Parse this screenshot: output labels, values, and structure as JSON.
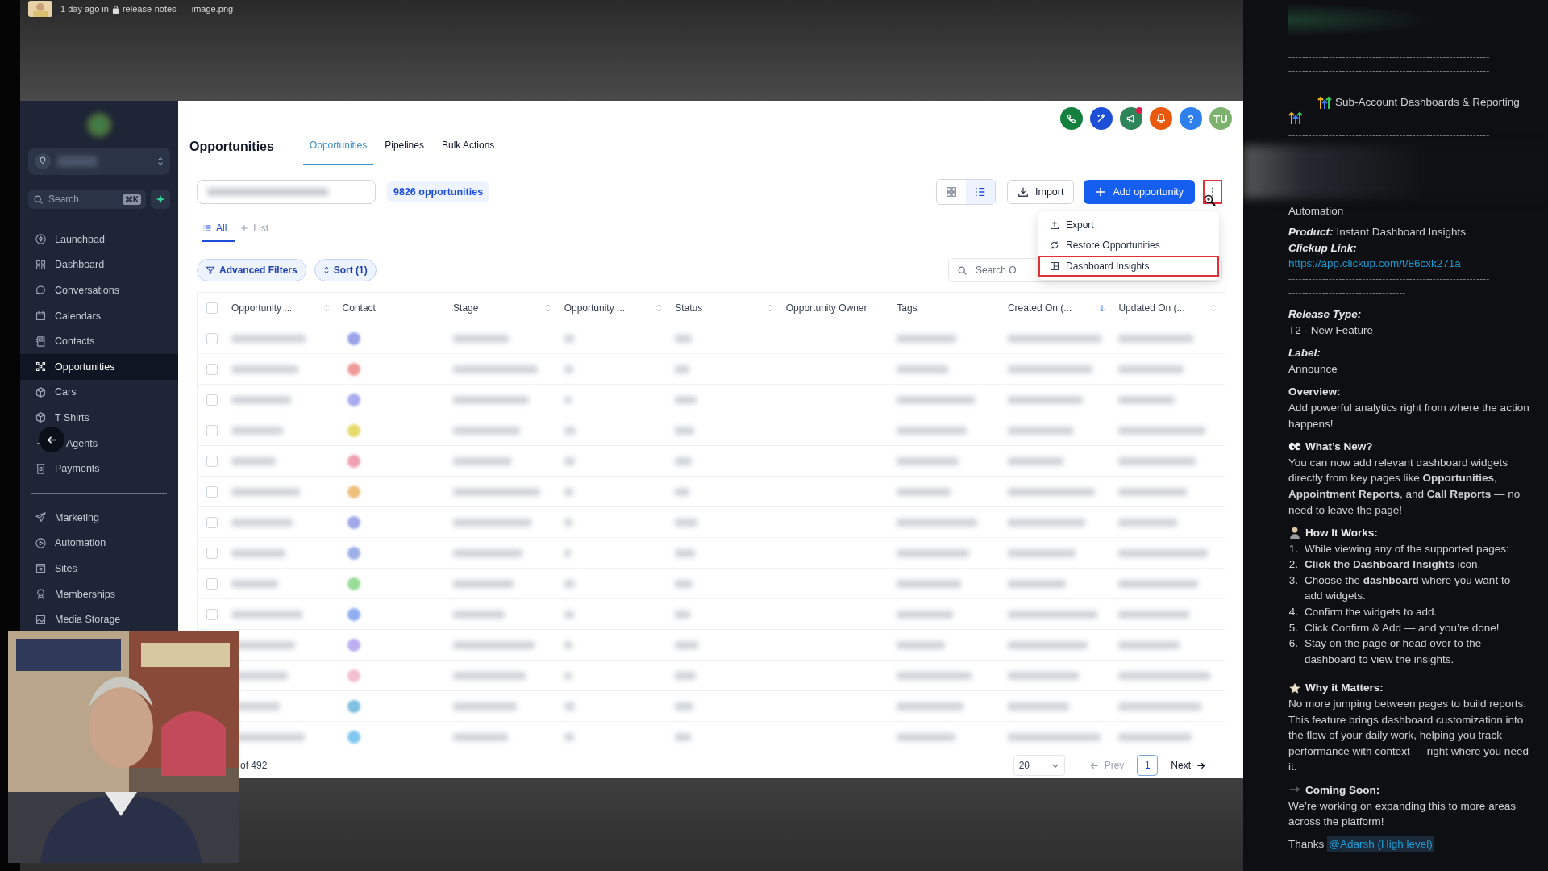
{
  "recording_bar": {
    "meta": "1 day ago in",
    "channel": "release-notes",
    "file": "– image.png"
  },
  "sidebar": {
    "search_placeholder": "Search",
    "shortcut": "⌘K",
    "items": [
      {
        "label": "Launchpad",
        "selected": false
      },
      {
        "label": "Dashboard",
        "selected": false
      },
      {
        "label": "Conversations",
        "selected": false
      },
      {
        "label": "Calendars",
        "selected": false
      },
      {
        "label": "Contacts",
        "selected": false
      },
      {
        "label": "Opportunities",
        "selected": true
      },
      {
        "label": "Cars",
        "selected": false
      },
      {
        "label": "T Shirts",
        "selected": false
      },
      {
        "label": "Agents",
        "selected": false
      },
      {
        "label": "Payments",
        "selected": false
      }
    ],
    "items_secondary": [
      {
        "label": "Marketing",
        "selected": false
      },
      {
        "label": "Automation",
        "selected": false
      },
      {
        "label": "Sites",
        "selected": false
      },
      {
        "label": "Memberships",
        "selected": false
      },
      {
        "label": "Media Storage",
        "selected": false
      }
    ]
  },
  "header": {
    "title": "Opportunities",
    "tabs": [
      {
        "label": "Opportunities",
        "selected": true
      },
      {
        "label": "Pipelines",
        "selected": false
      },
      {
        "label": "Bulk Actions",
        "selected": false
      }
    ],
    "icons": [
      {
        "kind": "phone",
        "color": "#15803d",
        "badge": false
      },
      {
        "kind": "magic",
        "color": "#1d4ed8",
        "badge": false
      },
      {
        "kind": "megaphone",
        "color": "#2f855a",
        "badge": true
      },
      {
        "kind": "bell",
        "color": "#ea580c",
        "badge": false
      },
      {
        "kind": "help",
        "color": "#2f80ed",
        "badge": false,
        "text": "?"
      },
      {
        "kind": "avatar",
        "color": "#7cb26e",
        "badge": false,
        "text": "TU"
      }
    ]
  },
  "toolbar": {
    "count": "9826 opportunities",
    "views": [
      {
        "kind": "grid",
        "selected": false
      },
      {
        "kind": "list",
        "selected": true
      }
    ],
    "import": "Import",
    "add": "Add opportunity",
    "more_highlighted": true
  },
  "menu": [
    {
      "label": "Export",
      "selected": false
    },
    {
      "label": "Restore Opportunities",
      "selected": false
    },
    {
      "label": "Dashboard Insights",
      "selected": true
    }
  ],
  "list_tabs": [
    {
      "label": "All",
      "selected": true
    },
    {
      "label": "List",
      "selected": false
    }
  ],
  "filters": {
    "advanced": "Advanced Filters",
    "sort": "Sort (1)",
    "search_placeholder": "Search O"
  },
  "table": {
    "header_checked": false,
    "columns": [
      {
        "label": "Opportunity ...",
        "sortable": true,
        "sorted_desc": false
      },
      {
        "label": "Contact",
        "sortable": false
      },
      {
        "label": "Stage",
        "sortable": true,
        "sorted_desc": false
      },
      {
        "label": "Opportunity ...",
        "sortable": true,
        "sorted_desc": false
      },
      {
        "label": "Status",
        "sortable": true,
        "sorted_desc": false
      },
      {
        "label": "Opportunity Owner",
        "sortable": false
      },
      {
        "label": "Tags",
        "sortable": false
      },
      {
        "label": "Created On (...",
        "sortable": true,
        "sorted_desc": true
      },
      {
        "label": "Updated On (...",
        "sortable": true,
        "sorted_desc": false
      }
    ],
    "rows": [
      {
        "checked": false,
        "color": "#9aa3e8"
      },
      {
        "checked": false,
        "color": "#f09a9a"
      },
      {
        "checked": false,
        "color": "#aaaaf0"
      },
      {
        "checked": false,
        "color": "#e6dc6e"
      },
      {
        "checked": false,
        "color": "#f0a0b0"
      },
      {
        "checked": false,
        "color": "#f0bf7a"
      },
      {
        "checked": false,
        "color": "#a0a8e8"
      },
      {
        "checked": false,
        "color": "#9eb0e8"
      },
      {
        "checked": false,
        "color": "#98dc98"
      },
      {
        "checked": false,
        "color": "#8eaef0"
      },
      {
        "color": "#bcaef0"
      },
      {
        "color": "#f2c0d0"
      },
      {
        "color": "#80c0e0"
      },
      {
        "color": "#80c8f0"
      }
    ]
  },
  "pagination": {
    "range": "of 492",
    "page_size": "20",
    "prev": "Prev",
    "prev_disabled": true,
    "pages": [
      {
        "label": "1",
        "selected": true
      }
    ],
    "next": "Next"
  },
  "thread": {
    "dashes_top": [
      "------------------------------------------------------------",
      "------------------------------------------------------------",
      "-------------------------------------"
    ],
    "heading": "Sub-Account Dashboards & Reporting",
    "dashes_mid": "------------------------------------------------------------",
    "category": "Automation",
    "product": {
      "label": "Product:",
      "value": "Instant Dashboard Insights"
    },
    "link_label": "Clickup Link:",
    "link": "https://app.clickup.com/t/86cxk271a",
    "dashes_after": [
      "------------------------------------------------------------",
      "-----------------------------------"
    ],
    "fields": [
      {
        "label": "Release Type:",
        "value": "T2 - New Feature"
      },
      {
        "label": "Label:",
        "value": "Announce"
      }
    ],
    "overview": {
      "title": "Overview:",
      "text": "Add powerful analytics right from where the action happens!"
    },
    "sections": [
      {
        "kind": "eyes",
        "title": "What’s New?",
        "text": "You can now add relevant dashboard widgets directly from key pages like **Opportunities**, **Appointment Reports**, and **Call Reports** — no need to leave the page!"
      },
      {
        "kind": "person",
        "title": "How It Works:",
        "steps": [
          {
            "number": "1.",
            "text": "While viewing any of the supported pages:"
          },
          {
            "number": "2.",
            "text": "**Click the Dashboard Insights** icon."
          },
          {
            "number": "3.",
            "text": "Choose the **dashboard** where you want to add widgets."
          },
          {
            "number": "4.",
            "text": "Confirm the widgets to add."
          },
          {
            "number": "5.",
            "text": "Click Confirm & Add — and you’re done!"
          },
          {
            "number": "6.",
            "text": "Stay on the page or head over to the dashboard to view the insights."
          }
        ]
      },
      {
        "kind": "star",
        "title": "Why it Matters:",
        "text": "No more jumping between pages to build reports. This feature brings dashboard customization into the flow of your daily work, helping you track performance with context — right where you need it."
      },
      {
        "kind": "arrow",
        "title": "Coming Soon:",
        "text": "We’re working on expanding this to more areas across the platform!"
      }
    ],
    "thanks": "Thanks",
    "mention": "@Adarsh (High level)"
  }
}
